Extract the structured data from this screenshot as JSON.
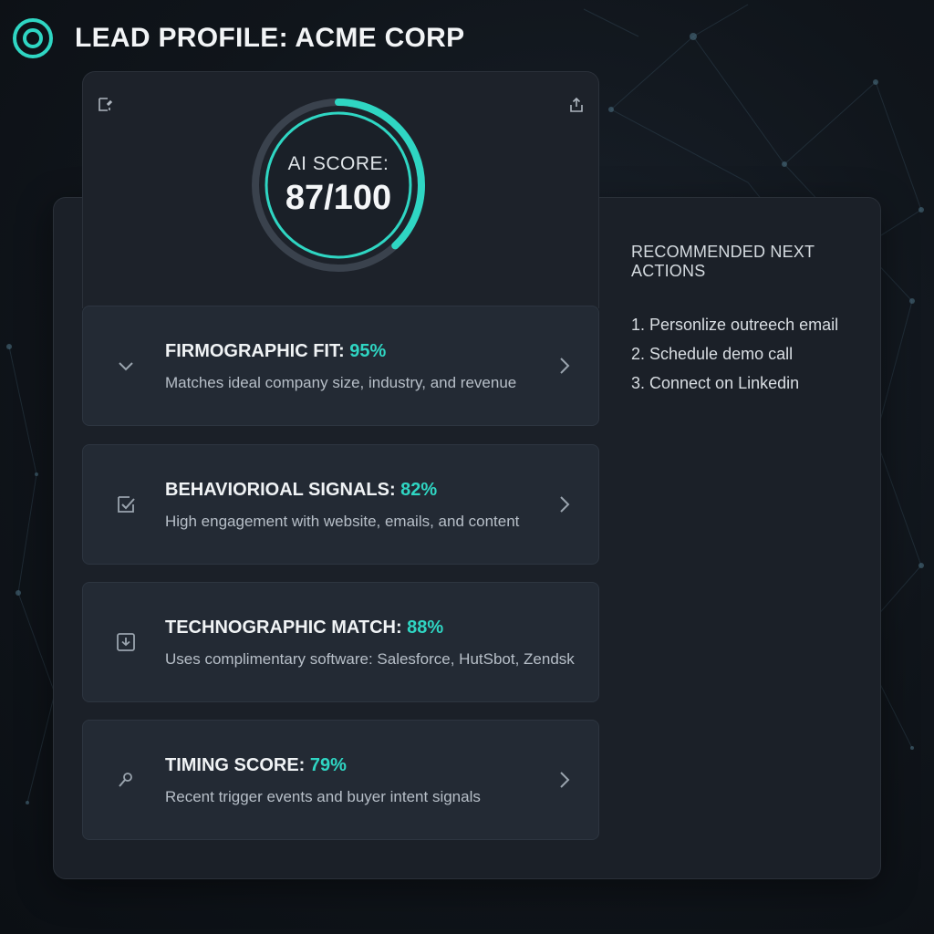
{
  "header": {
    "title": "LEAD PROFILE: ACME CORP",
    "logo_icon": "target-ring-icon"
  },
  "score": {
    "label": "AI SCORE:",
    "value_text": "87/100",
    "value": 87,
    "max": 100,
    "left_icon": "edit-icon",
    "right_icon": "share-icon"
  },
  "metrics": [
    {
      "title": "FIRMOGRAPHIC FIT: ",
      "percent": "95%",
      "description": "Matches ideal company size, industry, and revenue",
      "icon": "chevron-down-icon"
    },
    {
      "title": "BEHAVIORIOAL SIGNALS: ",
      "percent": "82%",
      "description": "High engagement with website, emails, and content",
      "icon": "checkbox-icon"
    },
    {
      "title": "TECHNOGRAPHIC MATCH: ",
      "percent": "88%",
      "description": "Uses complimentary software: Salesforce, HutSbot, Zendsk",
      "icon": "download-box-icon"
    },
    {
      "title": "TIMING SCORE: ",
      "percent": "79%",
      "description": "Recent trigger events and buyer intent signals",
      "icon": "pin-icon"
    }
  ],
  "actions": {
    "title": "RECOMMENDED NEXT ACTIONS",
    "items": [
      "1. Personlize outreech email",
      "2. Schedule demo call",
      "3. Connect on Linkedin"
    ]
  },
  "colors": {
    "accent": "#2fd6c3",
    "panel": "#1b2028",
    "card": "#232a34",
    "background": "#10151b"
  }
}
